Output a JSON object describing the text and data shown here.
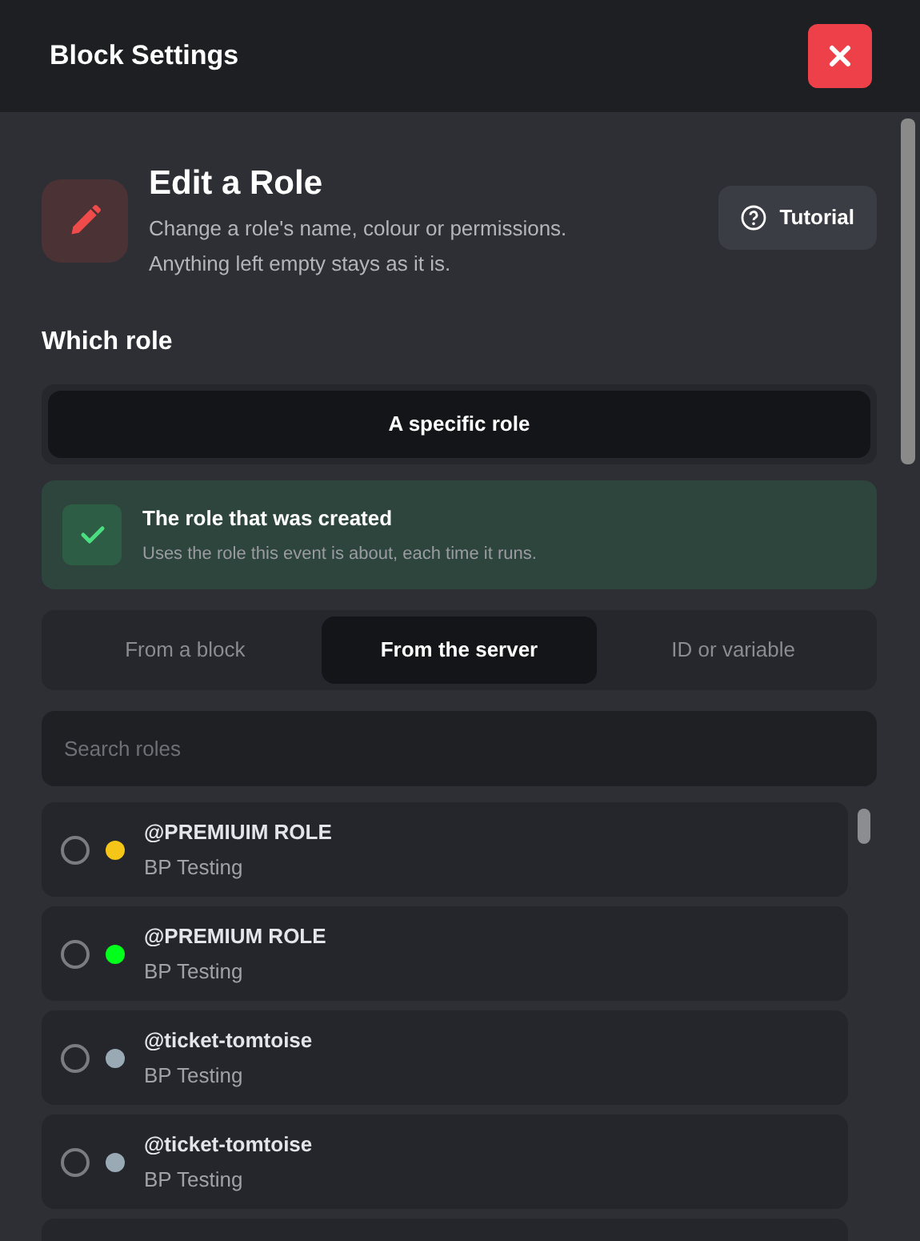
{
  "window": {
    "title": "Block Settings"
  },
  "header": {
    "title": "Edit a Role",
    "description": "Change a role's name, colour or permissions. Anything left empty stays as it is.",
    "tutorial_button": "Tutorial"
  },
  "which_role": {
    "label": "Which role",
    "modes": [
      {
        "label": "A specific role",
        "selected": true
      }
    ]
  },
  "created_role_option": {
    "title": "The role that was created",
    "description": "Uses the role this event is about, each time it runs.",
    "checked": true
  },
  "source_tabs": [
    {
      "label": "From a block",
      "selected": false
    },
    {
      "label": "From the server",
      "selected": true
    },
    {
      "label": "ID or variable",
      "selected": false
    }
  ],
  "search": {
    "placeholder": "Search roles"
  },
  "roles": [
    {
      "name": "@PREMIUIM ROLE",
      "server": "BP Testing",
      "color": "#f5c518",
      "selected": false
    },
    {
      "name": "@PREMIUM ROLE",
      "server": "BP Testing",
      "color": "#00ff1a",
      "selected": false
    },
    {
      "name": "@ticket-tomtoise",
      "server": "BP Testing",
      "color": "#99aab5",
      "selected": false
    },
    {
      "name": "@ticket-tomtoise",
      "server": "BP Testing",
      "color": "#99aab5",
      "selected": false
    }
  ]
}
